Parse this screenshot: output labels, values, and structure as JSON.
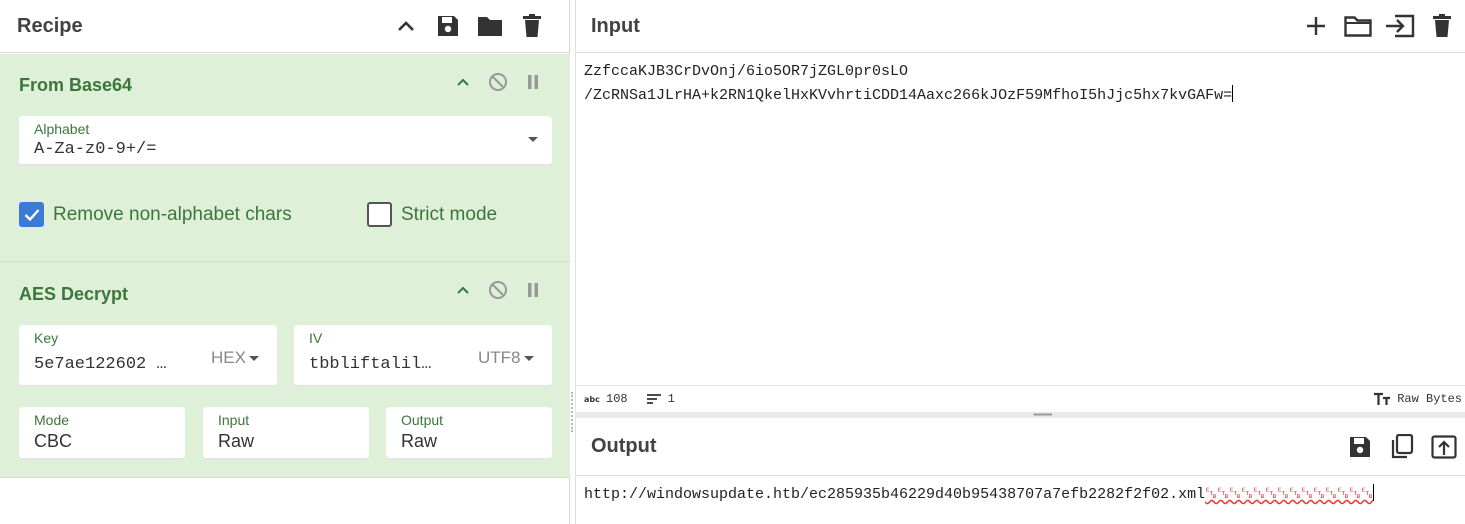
{
  "recipe": {
    "title": "Recipe",
    "operations": [
      {
        "name": "From Base64",
        "alphabet": {
          "label": "Alphabet",
          "value": "A-Za-z0-9+/="
        },
        "remove_non_alpha": {
          "label": "Remove non-alphabet chars",
          "checked": true
        },
        "strict_mode": {
          "label": "Strict mode",
          "checked": false
        }
      },
      {
        "name": "AES Decrypt",
        "key": {
          "label": "Key",
          "value": "5e7ae122602 …",
          "encoding": "HEX"
        },
        "iv": {
          "label": "IV",
          "value": "tbbliftalil…",
          "encoding": "UTF8"
        },
        "mode": {
          "label": "Mode",
          "value": "CBC"
        },
        "input": {
          "label": "Input",
          "value": "Raw"
        },
        "output": {
          "label": "Output",
          "value": "Raw"
        }
      }
    ]
  },
  "input": {
    "title": "Input",
    "lines": [
      "ZzfccaKJB3CrDvOnj/6io5OR7jZGL0pr0sLO",
      "/ZcRNSa1JLrHA+k2RN1QkelHxKVvhrtiCDD14Aaxc266kJOzF59MfhoI5hJjc5hx7kvGAFw="
    ],
    "stats": {
      "chars": "108",
      "lines": "1"
    },
    "format": "Raw Bytes"
  },
  "output": {
    "title": "Output",
    "text": "http://windowsupdate.htb/ec285935b46229d40b95438707a7efb2282f2f02.xml",
    "garbage": "␗␗␗␗␗␗␗␗␗␗␗␗␗␗"
  },
  "icons": [
    "chevron-up-icon",
    "save-icon",
    "folder-icon",
    "trash-icon",
    "disable-icon",
    "pause-icon",
    "plus-icon",
    "open-folder-icon",
    "import-icon",
    "copy-icon",
    "replace-input-icon",
    "text-size-icon",
    "abc-icon",
    "lines-icon"
  ],
  "colors": {
    "op_bg": "#dff0d8",
    "op_text": "#3c763d",
    "checkbox": "#3a7bd5"
  }
}
